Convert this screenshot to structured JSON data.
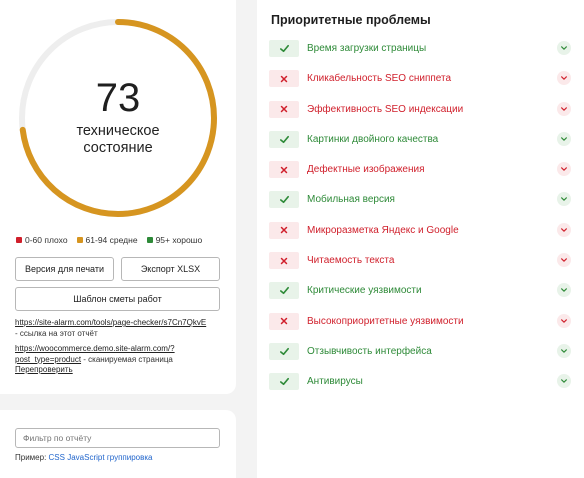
{
  "gauge": {
    "score": "73",
    "label_line1": "техническое",
    "label_line2": "состояние",
    "progress_fraction": 0.73,
    "track_color": "#eeeeee",
    "fill_color": "#d69520"
  },
  "legend": [
    {
      "label": "0-60 плохо",
      "color": "#d01f2b"
    },
    {
      "label": "61-94 средне",
      "color": "#d69520"
    },
    {
      "label": "95+ хорошо",
      "color": "#2e8a38"
    }
  ],
  "buttons": {
    "print": "Версия для печати",
    "xlsx": "Экспорт XLSX",
    "estimate": "Шаблон сметы работ"
  },
  "report_link": {
    "url": "https://site-alarm.com/tools/page-checker/s7Cn7QkvE",
    "note": " - ссылка на этот отчёт"
  },
  "scanned": {
    "url_part1": "https://woocommerce.demo.site-alarm.com/?",
    "url_part2": "post_type=product",
    "note": " - сканируемая страница",
    "recheck": "Перепроверить"
  },
  "filter": {
    "placeholder": "Фильтр по отчёту"
  },
  "example": {
    "prefix": "Пример:",
    "links": [
      "CSS",
      "JavaScript",
      "группировка"
    ]
  },
  "problems": {
    "title": "Приоритетные проблемы",
    "items": [
      {
        "label": "Время загрузки страницы",
        "status": "ok"
      },
      {
        "label": "Кликабельность SEO сниппета",
        "status": "bad"
      },
      {
        "label": "Эффективность SEO индексации",
        "status": "bad"
      },
      {
        "label": "Картинки двойного качества",
        "status": "ok"
      },
      {
        "label": "Дефектные изображения",
        "status": "bad"
      },
      {
        "label": "Мобильная версия",
        "status": "ok"
      },
      {
        "label": "Микроразметка Яндекс и Google",
        "status": "bad"
      },
      {
        "label": "Читаемость текста",
        "status": "bad"
      },
      {
        "label": "Критические уязвимости",
        "status": "ok"
      },
      {
        "label": "Высокоприоритетные уязвимости",
        "status": "bad"
      },
      {
        "label": "Отзывчивость интерфейса",
        "status": "ok"
      },
      {
        "label": "Антивирусы",
        "status": "ok"
      }
    ]
  }
}
